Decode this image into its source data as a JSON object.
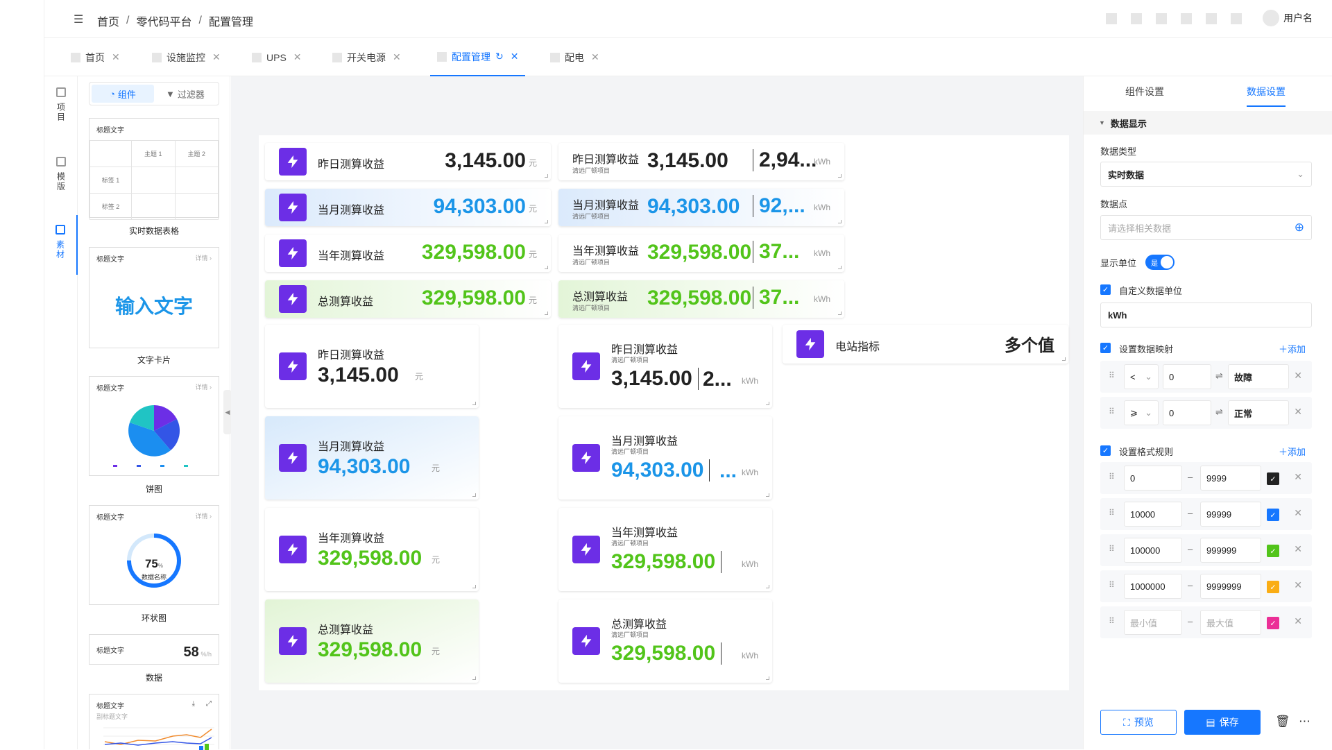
{
  "breadcrumb": {
    "home": "首页",
    "sep1": "/",
    "platform": "零代码平台",
    "sep2": "/",
    "current": "配置管理"
  },
  "user": {
    "name": "用户名"
  },
  "tabs": [
    {
      "label": "首页"
    },
    {
      "label": "设施监控"
    },
    {
      "label": "UPS"
    },
    {
      "label": "开关电源"
    },
    {
      "label": "配置管理"
    },
    {
      "label": "配电"
    }
  ],
  "leftnav": [
    {
      "label": "项目"
    },
    {
      "label": "模版"
    },
    {
      "label": "素材"
    }
  ],
  "palette": {
    "tab_components": "组件",
    "tab_filters": "过滤器",
    "items": [
      {
        "label": "实时数据表格",
        "title": "标题文字",
        "col1": "主题 1",
        "col2": "主题 2",
        "row1": "标签 1",
        "row2": "标签 2"
      },
      {
        "label": "文字卡片",
        "title": "标题文字",
        "detail": "详情 ›",
        "text": "输入文字"
      },
      {
        "label": "饼图",
        "title": "标题文字",
        "detail": "详情 ›"
      },
      {
        "label": "环状图",
        "title": "标题文字",
        "detail": "详情 ›",
        "value": "75",
        "unit": "%",
        "name": "数据名称"
      },
      {
        "label": "数据",
        "title": "标题文字",
        "value": "58",
        "unit": "%/h"
      },
      {
        "title": "标题文字",
        "subtitle": "副标题文字"
      }
    ]
  },
  "cards": {
    "small": [
      {
        "title": "昨日测算收益",
        "value": "3,145.00",
        "unit": "元"
      },
      {
        "title": "当月测算收益",
        "value": "94,303.00",
        "unit": "元"
      },
      {
        "title": "当年测算收益",
        "value": "329,598.00",
        "unit": "元"
      },
      {
        "title": "总测算收益",
        "value": "329,598.00",
        "unit": "元"
      }
    ],
    "small_multi": [
      {
        "title": "昨日测算收益",
        "sub": "清远厂顿项目",
        "value": "3,145.00",
        "value2": "2,94...",
        "unit": "kWh"
      },
      {
        "title": "当月测算收益",
        "sub": "清远厂顿项目",
        "value": "94,303.00",
        "value2": "92,...",
        "unit": "kWh"
      },
      {
        "title": "当年测算收益",
        "sub": "清远厂顿项目",
        "value": "329,598.00",
        "value2": "37...",
        "unit": "kWh"
      },
      {
        "title": "总测算收益",
        "sub": "清远厂顿项目",
        "value": "329,598.00",
        "value2": "37...",
        "unit": "kWh"
      }
    ],
    "big": [
      {
        "title": "昨日测算收益",
        "value": "3,145.00",
        "unit": "元"
      },
      {
        "title": "当月测算收益",
        "value": "94,303.00",
        "unit": "元"
      },
      {
        "title": "当年测算收益",
        "value": "329,598.00",
        "unit": "元"
      },
      {
        "title": "总测算收益",
        "value": "329,598.00",
        "unit": "元"
      }
    ],
    "big_multi": [
      {
        "title": "昨日测算收益",
        "sub": "清远厂顿项目",
        "value": "3,145.00",
        "value2": "2...",
        "unit": "kWh"
      },
      {
        "title": "当月测算收益",
        "sub": "清远厂顿项目",
        "value": "94,303.00",
        "value2": "...",
        "unit": "kWh"
      },
      {
        "title": "当年测算收益",
        "sub": "清远厂顿项目",
        "value": "329,598.00",
        "value2": "",
        "unit": "kWh"
      },
      {
        "title": "总测算收益",
        "sub": "清远厂顿项目",
        "value": "329,598.00",
        "value2": "",
        "unit": "kWh"
      }
    ],
    "station": {
      "title": "电站指标",
      "value": "多个值"
    }
  },
  "settings": {
    "tab_component": "组件设置",
    "tab_data": "数据设置",
    "section": "数据显示",
    "data_type_label": "数据类型",
    "data_type_value": "实时数据",
    "data_point_label": "数据点",
    "data_point_placeholder": "请选择相关数据",
    "show_unit_label": "显示单位",
    "toggle_text": "是",
    "custom_unit_label": "自定义数据单位",
    "custom_unit_value": "kWh",
    "mapping_label": "设置数据映射",
    "add": "添加",
    "mappings": [
      {
        "op": "<",
        "value": "0",
        "result": "故障"
      },
      {
        "op": "⩾",
        "value": "0",
        "result": "正常"
      }
    ],
    "format_label": "设置格式规则",
    "rules": [
      {
        "min": "0",
        "max": "9999",
        "color": "#222222"
      },
      {
        "min": "10000",
        "max": "99999",
        "color": "#1677ff"
      },
      {
        "min": "100000",
        "max": "999999",
        "color": "#52c41a"
      },
      {
        "min": "1000000",
        "max": "9999999",
        "color": "#faad14"
      },
      {
        "min": "",
        "max": "",
        "min_ph": "最小值",
        "max_ph": "最大值",
        "color": "#eb2f96"
      }
    ],
    "preview": "预览",
    "save": "保存"
  },
  "colors": {
    "accent": "#1677ff",
    "bolt": "#6c2ee6",
    "blue_value": "#1b95e8",
    "green_value": "#52c41a"
  }
}
